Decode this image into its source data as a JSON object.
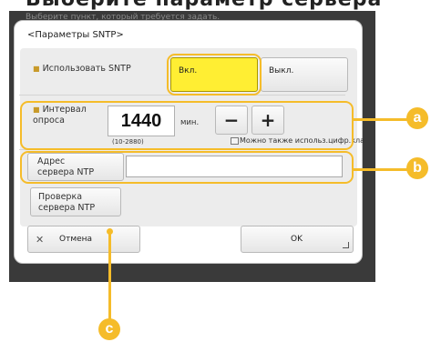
{
  "page_heading": "Выберите параметр сервера",
  "background_ghost_text": "Выберите пункт, который требуется задать.",
  "dialog": {
    "title": "<Параметры SNTP>",
    "use_sntp": {
      "label": "Использовать SNTP",
      "on_label": "Вкл.",
      "off_label": "Выкл.",
      "selected": "Вкл."
    },
    "poll_interval": {
      "label": "Интервал опроса",
      "value": "1440",
      "unit": "мин.",
      "range": "(10-2880)",
      "minus_label": "−",
      "plus_label": "+",
      "hint": "Можно также использ.цифр.кла"
    },
    "ntp_server": {
      "label": "Адрес сервера NTP",
      "value": ""
    },
    "check_button_label": "Проверка сервера NTP",
    "cancel_label": "Отмена",
    "ok_label": "OK"
  },
  "callouts": {
    "a": "a",
    "b": "b",
    "c": "c"
  },
  "colors": {
    "accent": "#f5bc2a",
    "selected_button": "#ffee33",
    "panel": "#ececec"
  }
}
